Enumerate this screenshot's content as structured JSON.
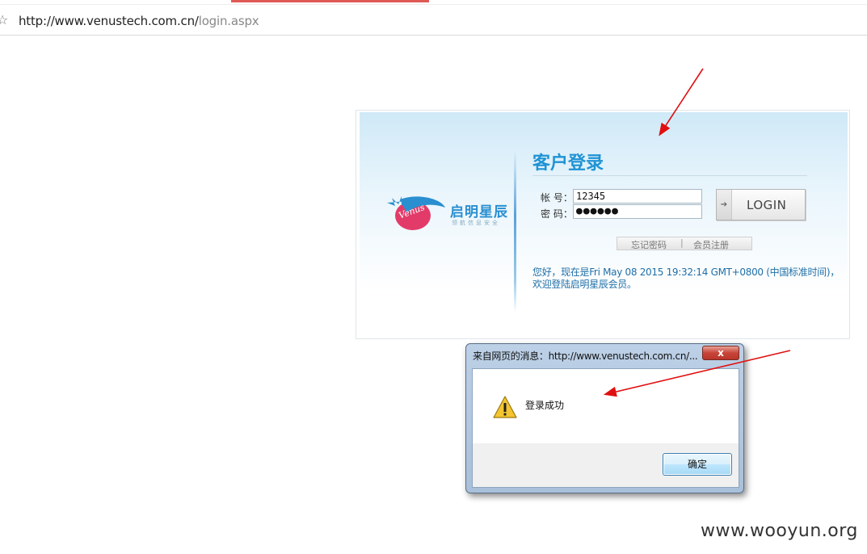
{
  "browser": {
    "url_host": "http://www.venustech.com.cn/",
    "url_path": "login.aspx"
  },
  "logo": {
    "mark_text": "Venus",
    "name": "启明星辰",
    "subtitle": "领航信息安全"
  },
  "login": {
    "title": "客户登录",
    "username_label": "帐 号：",
    "password_label": "密 码：",
    "username_value": "12345",
    "password_masked": "●●●●●●",
    "login_button": "LOGIN",
    "forgot_link": "忘记密码",
    "separator": "|",
    "register_link": "会员注册",
    "welcome_line1": "您好，现在是Fri May 08 2015 19:32:14 GMT+0800 (中国标准时间)，",
    "welcome_line2": "欢迎登陆启明星辰会员。"
  },
  "dialog": {
    "title": "来自网页的消息：http://www.venustech.com.cn/...",
    "close_label": "x",
    "message": "登录成功",
    "ok_button": "确定"
  },
  "watermark": "www.wooyun.org",
  "colors": {
    "brand_blue": "#1f93d4",
    "annotation_red": "#e01010",
    "logo_pink": "#e23b6a"
  }
}
